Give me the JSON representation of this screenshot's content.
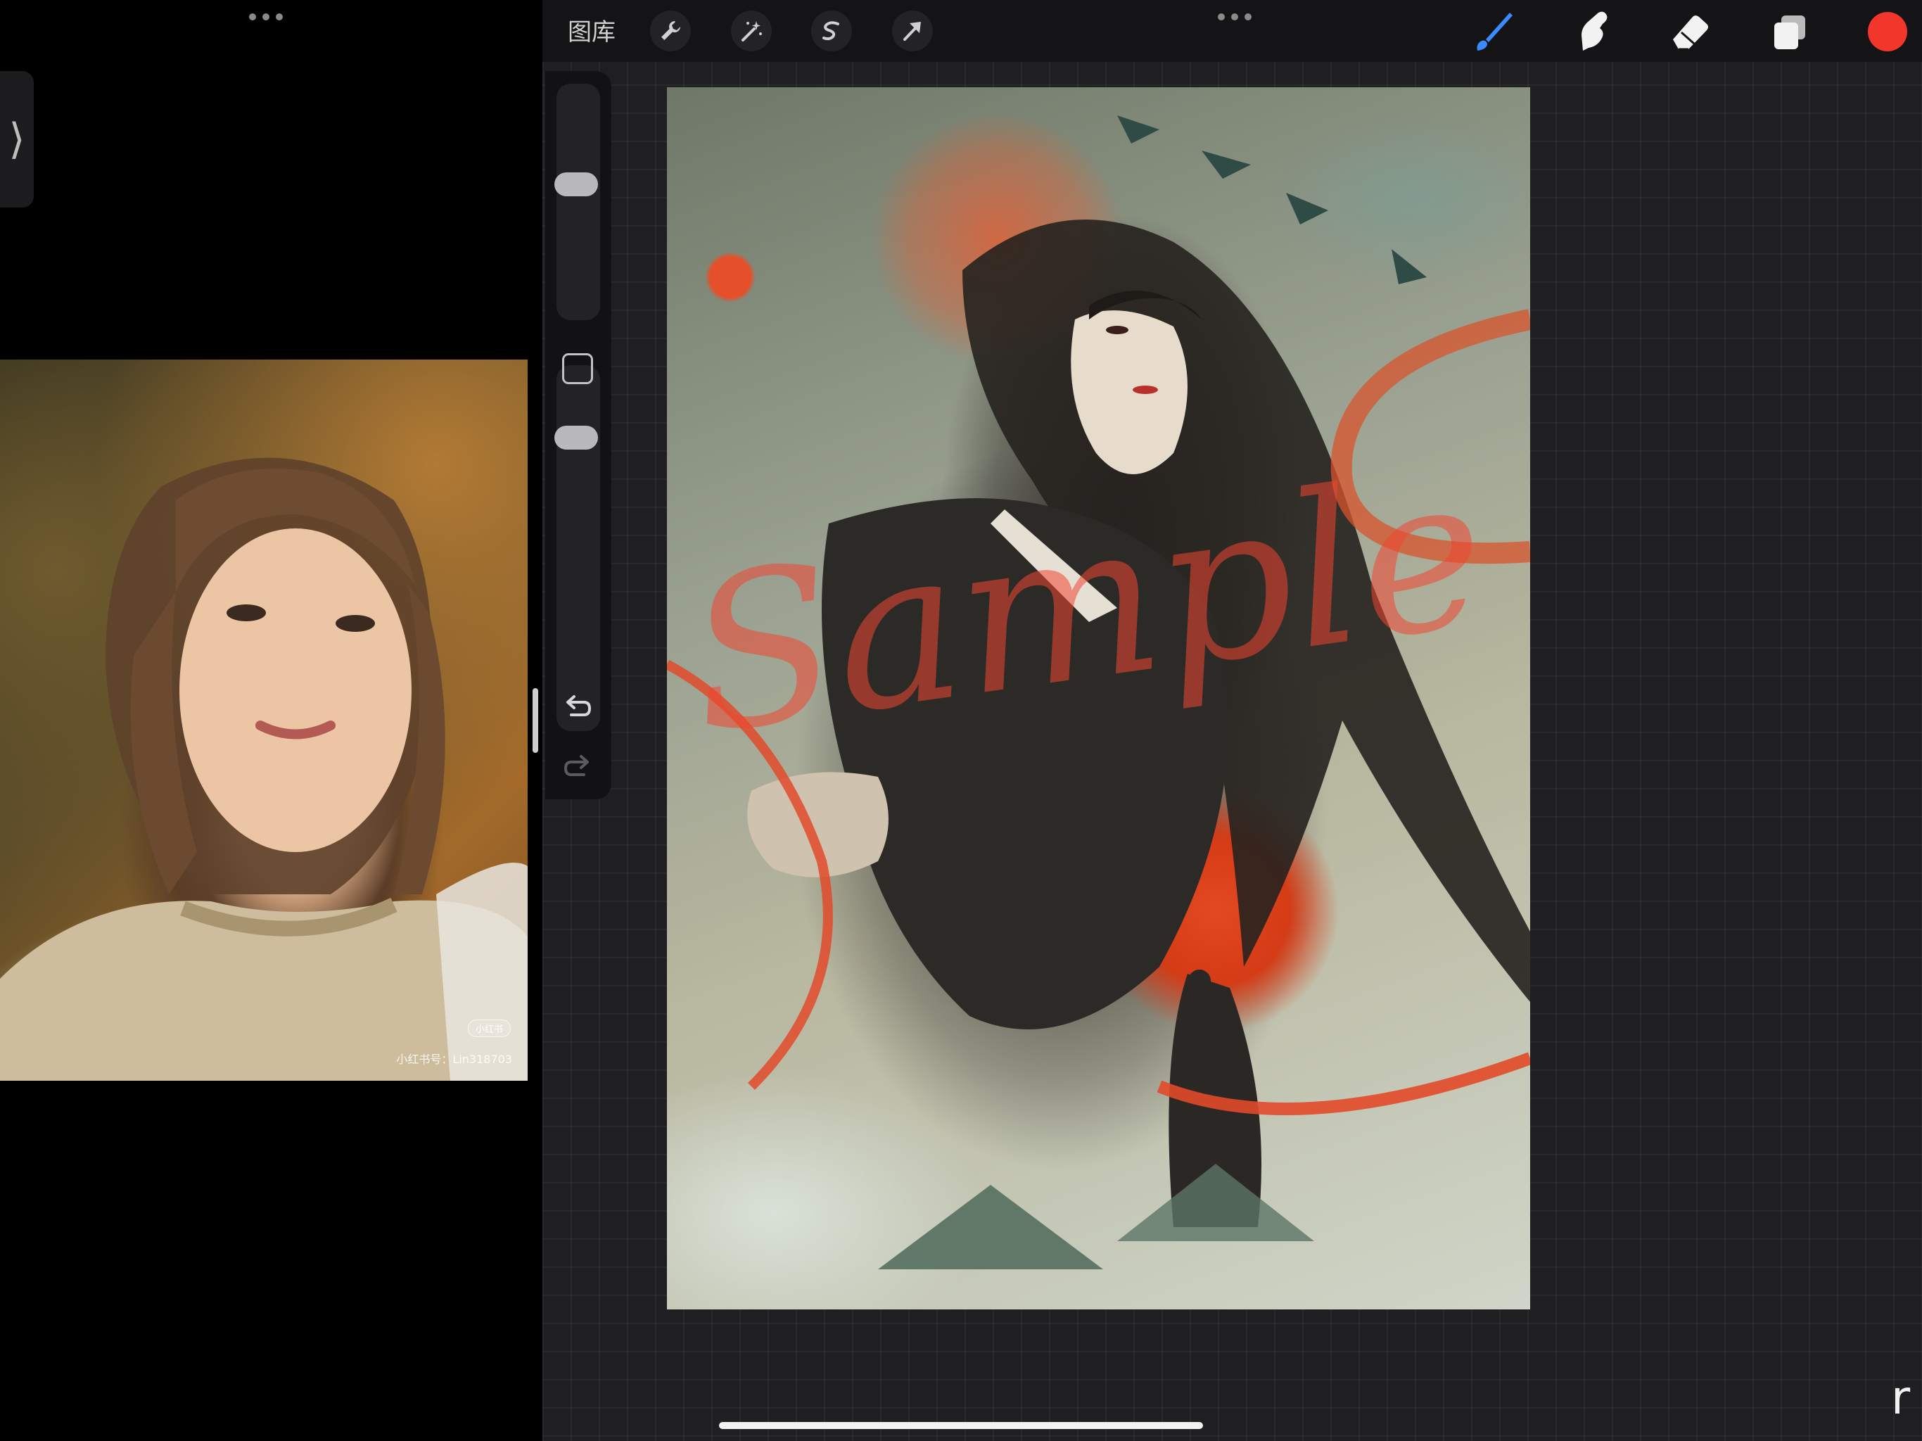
{
  "left_pane": {
    "reference_photo": {
      "badge": "小红书",
      "caption": "小红书号：Lin318703"
    }
  },
  "procreate": {
    "top_bar": {
      "gallery_label": "图库",
      "active_color": "#f2362b",
      "brush_color": "#3a8bff"
    }
  },
  "canvas": {
    "watermark_text": "Sample"
  },
  "corner_glyph": "r"
}
